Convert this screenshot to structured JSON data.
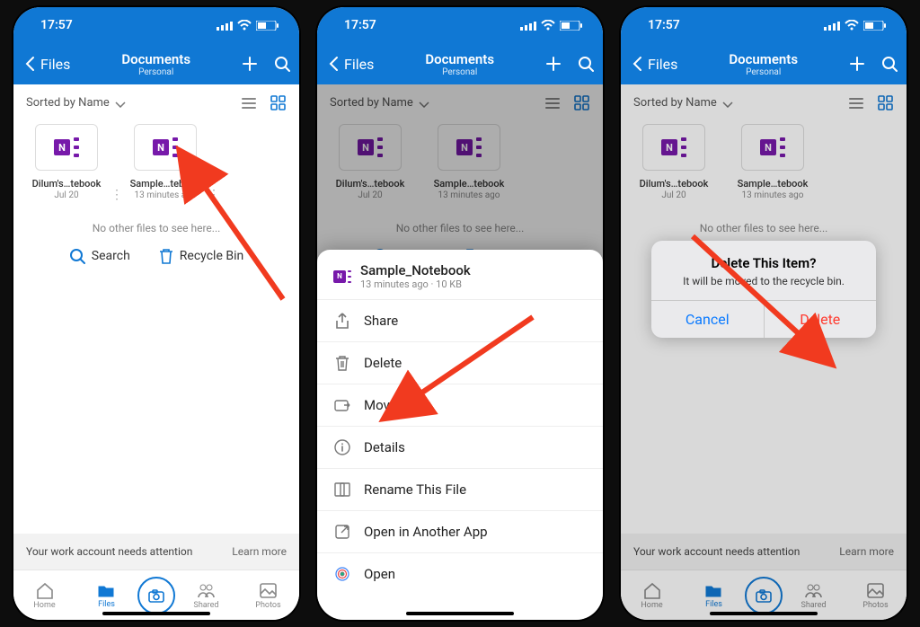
{
  "status": {
    "time": "17:57"
  },
  "nav": {
    "back": "Files",
    "title": "Documents",
    "subtitle": "Personal"
  },
  "sort": {
    "label": "Sorted by Name"
  },
  "files": [
    {
      "name": "Dilum's…tebook",
      "sub": "Jul 20"
    },
    {
      "name": "Sample…tebook",
      "sub": "13 minutes ago"
    }
  ],
  "noMore": "No other files to see here...",
  "actions": {
    "search": "Search",
    "recycle": "Recycle Bin"
  },
  "attention": {
    "text": "Your work account needs attention",
    "link": "Learn more"
  },
  "tabs": {
    "home": "Home",
    "files": "Files",
    "shared": "Shared",
    "photos": "Photos"
  },
  "sheet": {
    "title": "Sample_Notebook",
    "sub": "13 minutes ago · 10 KB",
    "items": {
      "share": "Share",
      "delete": "Delete",
      "move": "Move",
      "details": "Details",
      "rename": "Rename This File",
      "openOther": "Open in Another App",
      "open": "Open"
    }
  },
  "alert": {
    "title": "Delete This Item?",
    "message": "It will be moved to the recycle bin.",
    "cancel": "Cancel",
    "delete": "Delete"
  }
}
